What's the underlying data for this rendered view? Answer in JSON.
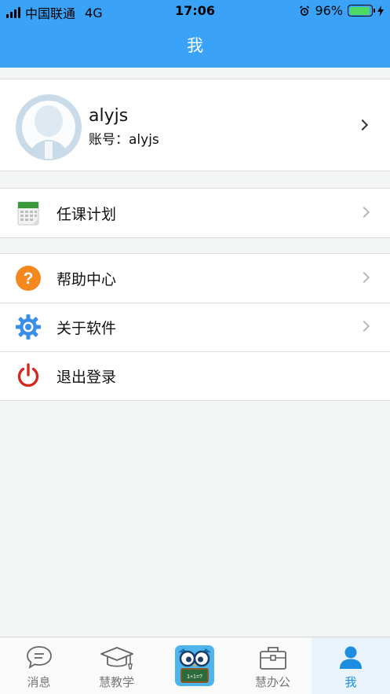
{
  "status_bar": {
    "carrier": "中国联通",
    "network": "4G",
    "time": "17:06",
    "battery": "96%",
    "battery_level": 0.96,
    "alarm_icon": "alarm-clock-icon"
  },
  "header": {
    "title": "我"
  },
  "profile": {
    "name": "alyjs",
    "account": "账号：alyjs",
    "avatar_icon": "avatar-placeholder-icon"
  },
  "menu": {
    "group1": [
      {
        "label": "任课计划",
        "icon": "calendar-icon"
      }
    ],
    "group2": [
      {
        "label": "帮助中心",
        "icon": "help-question-icon"
      },
      {
        "label": "关于软件",
        "icon": "gear-icon"
      },
      {
        "label": "退出登录",
        "icon": "power-icon"
      }
    ]
  },
  "tabbar": {
    "tabs": [
      {
        "label": "消息",
        "icon": "chat-bubble-icon"
      },
      {
        "label": "慧教学",
        "icon": "graduation-cap-icon"
      },
      {
        "label": "",
        "icon": "owl-app-logo-icon"
      },
      {
        "label": "慧办公",
        "icon": "briefcase-icon"
      },
      {
        "label": "我",
        "icon": "person-icon"
      }
    ],
    "active_index": 4
  },
  "colors": {
    "header": "#3aa3f8",
    "active_tab": "#1d8de0",
    "help_icon": "#f5871f",
    "gear_icon": "#3a8ee6",
    "power_icon": "#d42a1e"
  }
}
